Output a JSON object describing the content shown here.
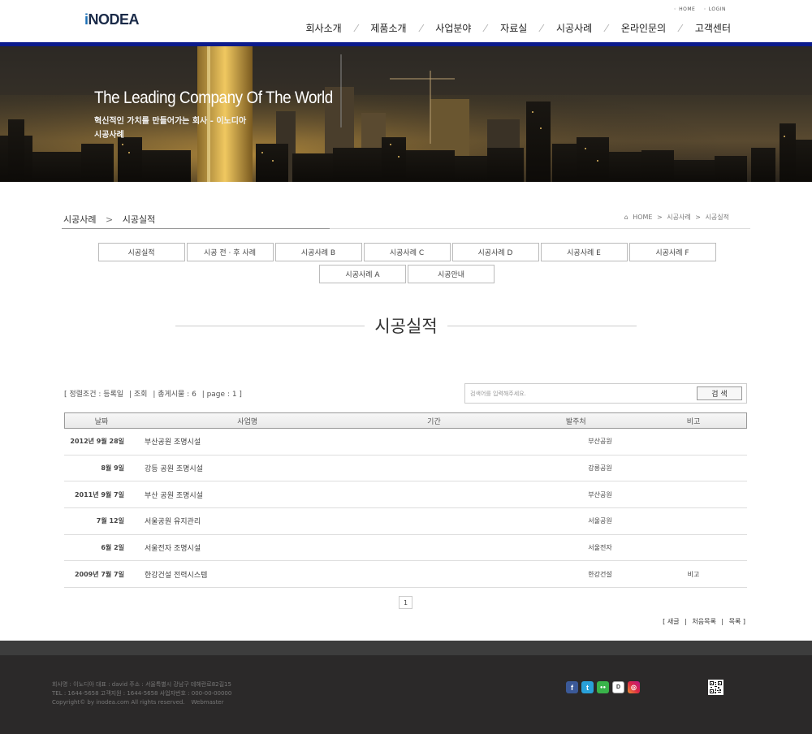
{
  "header": {
    "logo_first": "i",
    "logo_rest": "NODEA",
    "top_links": [
      "HOME",
      "LOGIN"
    ],
    "menu": [
      "회사소개",
      "제품소개",
      "사업분야",
      "자료실",
      "시공사례",
      "온라인문의",
      "고객센터"
    ]
  },
  "hero": {
    "title": "The Leading Company Of The World",
    "subtitle": "혁신적인 가치를 만들어가는 회사 - 이노디아",
    "page_name": "시공사례"
  },
  "subnav": {
    "section": "시공사례",
    "current": "시공실적",
    "location": [
      "HOME",
      "시공사례",
      "시공실적"
    ]
  },
  "tabs": [
    "시공실적",
    "시공 전 · 후 사례",
    "시공사례 B",
    "시공사례 C",
    "시공사례 D",
    "시공사례 E",
    "시공사례 F",
    "시공사례 A",
    "시공안내"
  ],
  "section_title": "시공실적",
  "list_info": {
    "sort": "[ 정렬조건 : 등록일",
    "views": "|  조회",
    "total": "|  총게시물 : 6",
    "page": "|  page : 1 ]"
  },
  "search": {
    "placeholder": "검색어를 입력해주세요.",
    "button": "검 색"
  },
  "table": {
    "headers": [
      "날짜",
      "사업명",
      "기간",
      "발주처",
      "비고"
    ],
    "rows": [
      {
        "date": "2012년 9월   28일",
        "title": "부산공원 조명시설",
        "period": "",
        "client": "부산공원",
        "note": ""
      },
      {
        "date": "8월   9일",
        "title": "강등 공원 조명시설",
        "period": "",
        "client": "강릉공원",
        "note": ""
      },
      {
        "date": "2011년 9월   7일",
        "title": "부산 공원 조명시설",
        "period": "",
        "client": "부산공원",
        "note": ""
      },
      {
        "date": "7월   12일",
        "title": "서울공원 유지관리",
        "period": "",
        "client": "서울공원",
        "note": ""
      },
      {
        "date": "6월   2일",
        "title": "서울전자 조명시설",
        "period": "",
        "client": "서울전자",
        "note": ""
      },
      {
        "date": "2009년 7월   7일",
        "title": "한강건설 전력시스템",
        "period": "",
        "client": "한강건설",
        "note": "비고"
      }
    ]
  },
  "pager": "1",
  "bottom_links": {
    "write": "[ 새글",
    "first": "처음목록",
    "list": "목록 ]"
  },
  "footer": {
    "line1": "회사명 : 이노디아    대표 : david    주소 : 서울특별시 강남구 테헤란로82길15",
    "line2": "TEL : 1644-5658    고객지원 : 1644-5658    사업자번호 : 000-00-00000",
    "line3": "Copyright© by inodea.com All rights reserved.",
    "webmaster": "Webmaster"
  },
  "sns_icons": [
    "facebook-icon",
    "twitter-icon",
    "line-icon",
    "kakaostory-icon",
    "instagram-icon"
  ],
  "colors": {
    "nav_bar": "#0b1a8c",
    "logo_blue": "#1c6fb5",
    "footer_bg": "#2b2929"
  }
}
